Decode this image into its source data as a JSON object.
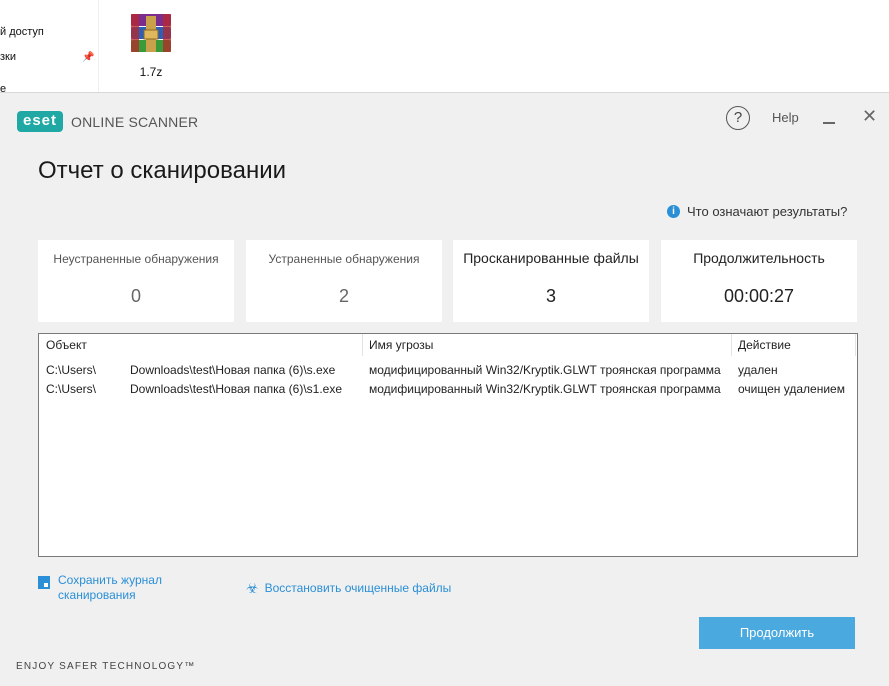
{
  "explorer": {
    "nav_items": [
      "й доступ",
      "зки",
      "e"
    ],
    "file": {
      "name": "1.7z",
      "icon": "winrar-archive-icon"
    }
  },
  "app": {
    "logo_badge": "eset",
    "product_name": "ONLINE SCANNER",
    "help_label": "Help",
    "help_icon": "question-icon",
    "minimize_icon": "minimize-icon",
    "close_icon": "close-icon",
    "accent": "#1fa8a4",
    "link_color": "#2a8fd6",
    "button_color": "#4aa9de"
  },
  "page": {
    "title": "Отчет о сканировании",
    "info_link": "Что означают результаты?"
  },
  "stats": [
    {
      "caption": "Неустраненные обнаружения",
      "value": "0"
    },
    {
      "caption": "Устраненные обнаружения",
      "value": "2"
    },
    {
      "caption": "Просканированные файлы",
      "value": "3"
    },
    {
      "caption": "Продолжительность",
      "value": "00:00:27"
    }
  ],
  "table": {
    "columns": [
      "Объект",
      "Имя угрозы",
      "Действие"
    ],
    "rows": [
      {
        "object_prefix": "C:\\Users\\",
        "object_suffix": "Downloads\\test\\Новая папка (6)\\s.exe",
        "threat": "модифицированный Win32/Kryptik.GLWT троянская программа",
        "action": "удален"
      },
      {
        "object_prefix": "C:\\Users\\",
        "object_suffix": "Downloads\\test\\Новая папка (6)\\s1.exe",
        "threat": "модифицированный Win32/Kryptik.GLWT троянская программа",
        "action": "очищен удалением"
      }
    ]
  },
  "actions": {
    "save_log_line1": "Сохранить журнал",
    "save_log_line2": "сканирования",
    "restore_files": "Восстановить очищенные файлы",
    "continue": "Продолжить"
  },
  "footer": {
    "tagline": "ENJOY SAFER TECHNOLOGY™"
  }
}
